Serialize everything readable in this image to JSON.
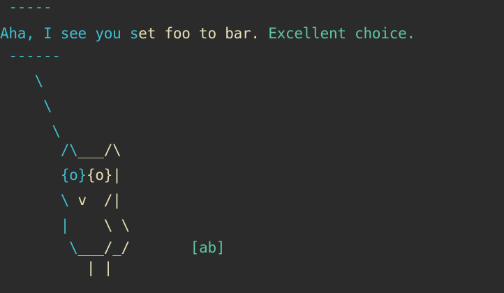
{
  "terminal": {
    "colors": {
      "background": "#2b2b2b",
      "cyan": "#3fc0cf",
      "cream": "#e8dfb4",
      "green": "#5ec6a4"
    },
    "lines": [
      [
        {
          "text": " -----",
          "color": "cyan"
        }
      ],
      [
        {
          "text": "Aha, I see you s",
          "color": "cyan"
        },
        {
          "text": "et foo to bar. ",
          "color": "cream"
        },
        {
          "text": "Excellent choice.",
          "color": "green"
        }
      ],
      [
        {
          "text": " ------",
          "color": "cyan"
        }
      ],
      [
        {
          "text": "    \\",
          "color": "cyan"
        }
      ],
      [
        {
          "text": "     \\",
          "color": "cyan"
        }
      ],
      [
        {
          "text": "      \\",
          "color": "cyan"
        }
      ],
      [
        {
          "text": "       /\\",
          "color": "cyan"
        },
        {
          "text": "___/\\",
          "color": "cream"
        }
      ],
      [
        {
          "text": "       {o}",
          "color": "cyan"
        },
        {
          "text": "{o}|",
          "color": "cream"
        }
      ],
      [
        {
          "text": "       \\",
          "color": "cyan"
        },
        {
          "text": " v  /|",
          "color": "cream"
        }
      ],
      [
        {
          "text": "       |",
          "color": "cyan"
        },
        {
          "text": "    \\ \\",
          "color": "cream"
        }
      ],
      [
        {
          "text": "        \\",
          "color": "cyan"
        },
        {
          "text": "___/_/",
          "color": "cream"
        },
        {
          "text": "       ",
          "color": "cream"
        },
        {
          "text": "[ab]",
          "color": "green"
        }
      ],
      [
        {
          "text": "          | |",
          "color": "cream"
        }
      ]
    ]
  }
}
